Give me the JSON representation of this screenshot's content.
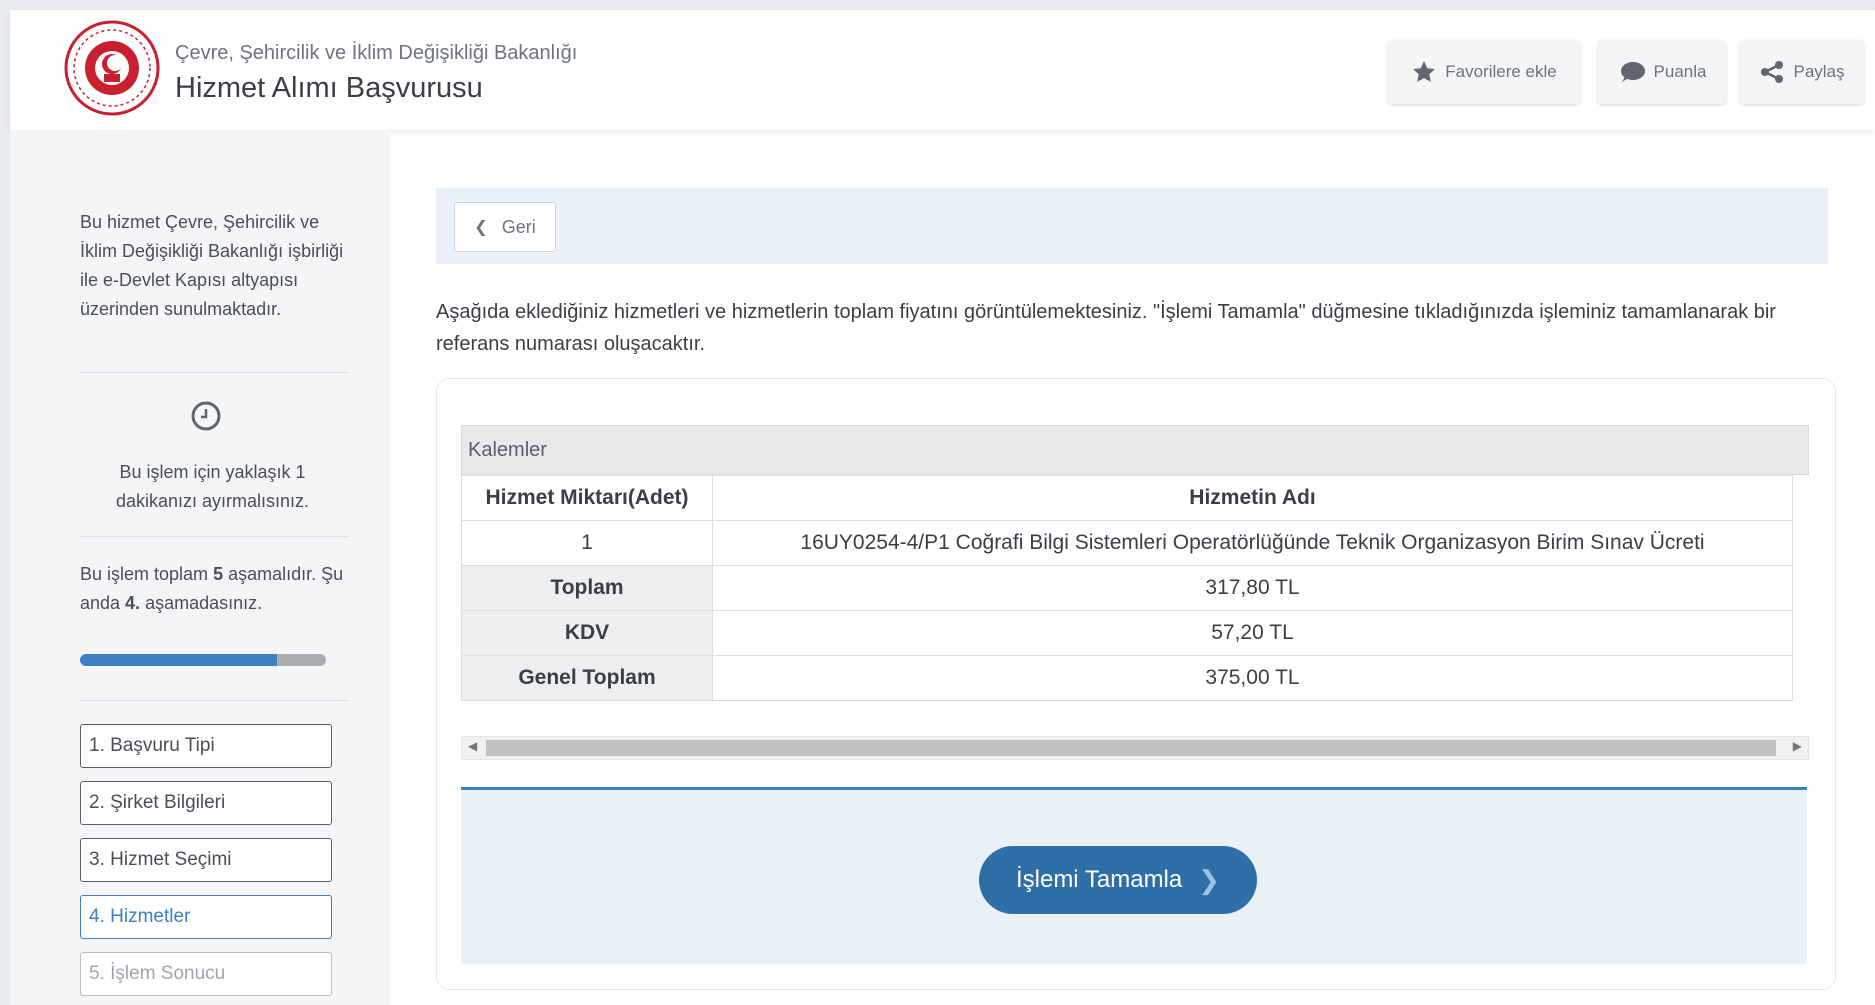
{
  "header": {
    "ministry": "Çevre, Şehircilik ve İklim Değişikliği Bakanlığı",
    "title": "Hizmet Alımı Başvurusu",
    "buttons": {
      "favorite": "Favorilere ekle",
      "rate": "Puanla",
      "share": "Paylaş"
    }
  },
  "sidebar": {
    "intro": "Bu hizmet Çevre, Şehircilik ve İklim Değişikliği Bakanlığı işbirliği ile e-Devlet Kapısı altyapısı üzerinden sunulmaktadır.",
    "time_note": "Bu işlem için yaklaşık 1 dakikanızı ayırmalısınız.",
    "steps_note": {
      "prefix": "Bu işlem toplam ",
      "total": "5",
      "middle": " aşamalıdır. Şu anda ",
      "current": "4.",
      "suffix": " aşamadasınız."
    },
    "progress": 0.8,
    "steps": [
      {
        "label": "1. Başvuru Tipi",
        "state": "done"
      },
      {
        "label": "2. Şirket Bilgileri",
        "state": "done"
      },
      {
        "label": "3. Hizmet Seçimi",
        "state": "done"
      },
      {
        "label": "4. Hizmetler",
        "state": "active"
      },
      {
        "label": "5. İşlem Sonucu",
        "state": "disabled"
      }
    ]
  },
  "main": {
    "back_label": "Geri",
    "info": "Aşağıda eklediğiniz hizmetleri ve hizmetlerin toplam fiyatını görüntülemektesiniz. \"İşlemi Tamamla\" düğmesine tıkladığınızda işleminiz tamamlanarak bir referans numarası oluşacaktır.",
    "table": {
      "caption": "Kalemler",
      "headers": [
        "Hizmet Miktarı(Adet)",
        "Hizmetin Adı"
      ],
      "row": {
        "qty": "1",
        "name": "16UY0254-4/P1 Coğrafi Bilgi Sistemleri Operatörlüğünde Teknik Organizasyon Birim Sınav Ücreti"
      },
      "totals": [
        {
          "label": "Toplam",
          "value": "317,80 TL"
        },
        {
          "label": "KDV",
          "value": "57,20 TL"
        },
        {
          "label": "Genel Toplam",
          "value": "375,00 TL"
        }
      ]
    },
    "complete_label": "İşlemi Tamamla"
  },
  "colors": {
    "accent": "#2f6fa8",
    "progress": "#3d7fc1",
    "logo_red": "#c8202f"
  }
}
